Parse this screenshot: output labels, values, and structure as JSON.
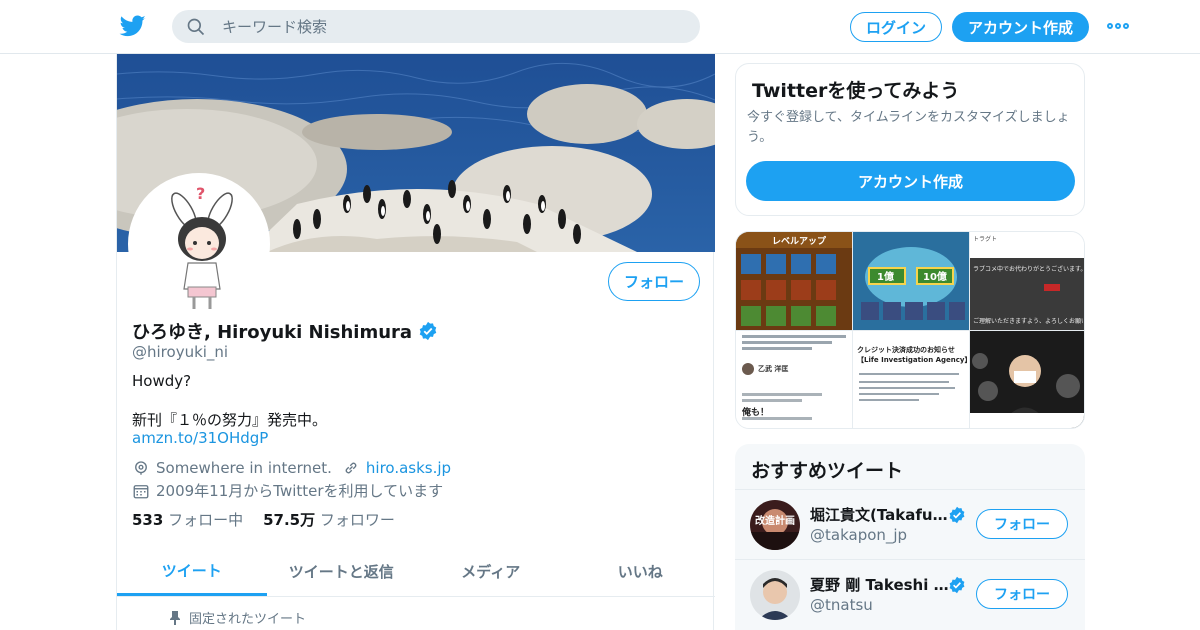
{
  "header": {
    "search_placeholder": "キーワード検索",
    "login_label": "ログイン",
    "signup_label": "アカウント作成"
  },
  "profile": {
    "name": "ひろゆき, Hiroyuki Nishimura",
    "handle": "@hiroyuki_ni",
    "follow_label": "フォロー",
    "bio_line1": "Howdy?",
    "bio_line2": "新刊『１％の努力』発売中。",
    "bio_link": "amzn.to/31OHdgP",
    "location": "Somewhere in internet.",
    "website": "hiro.asks.jp",
    "joined": "2009年11月からTwitterを利用しています",
    "following_count": "533",
    "following_label": "フォロー中",
    "followers_count": "57.5万",
    "followers_label": "フォロワー",
    "verified": true
  },
  "tabs": [
    "ツイート",
    "ツイートと返信",
    "メディア",
    "いいね"
  ],
  "active_tab": 0,
  "pinned_label": "固定されたツイート",
  "signup_card": {
    "title": "Twitterを使ってみよう",
    "description": "今すぐ登録して、タイムラインをカスタマイズしましょう。",
    "button_label": "アカウント作成"
  },
  "media_thumbs": [
    {
      "caption": "レベルアップ"
    },
    {
      "caption": ""
    },
    {
      "caption": ""
    },
    {
      "caption": ""
    },
    {
      "caption": "クレジット決済成功のお知らせ"
    },
    {
      "caption": ""
    }
  ],
  "media_texts": {
    "game_top_label": "レベルアップ",
    "game2_left": "1億",
    "game2_right": "10億",
    "shot3_line1": "トラグト",
    "shot3_line2": "ラブコメ中でお代わりがとうございます。",
    "shot3_line3": "ご理解いただきますよう、よろしくお願いいたします。",
    "shot4_name": "乙武 洋匡",
    "shot4_reply": "俺も！",
    "shot5_title_line1": "クレジット決済成功のお知らせ",
    "shot5_title_line2": "【Life Investigation Agency】"
  },
  "recommendations": {
    "title": "おすすめツイート",
    "items": [
      {
        "name": "堀江貴文(Takafumi Horie)",
        "handle": "@takapon_jp",
        "follow_label": "フォロー",
        "avatar_text": "改造計画"
      },
      {
        "name": "夏野 剛 Takeshi Natsuno",
        "handle": "@tnatsu",
        "follow_label": "フォロー"
      }
    ]
  },
  "colors": {
    "accent": "#1da1f2",
    "link": "#1b95e0",
    "muted": "#657786"
  }
}
